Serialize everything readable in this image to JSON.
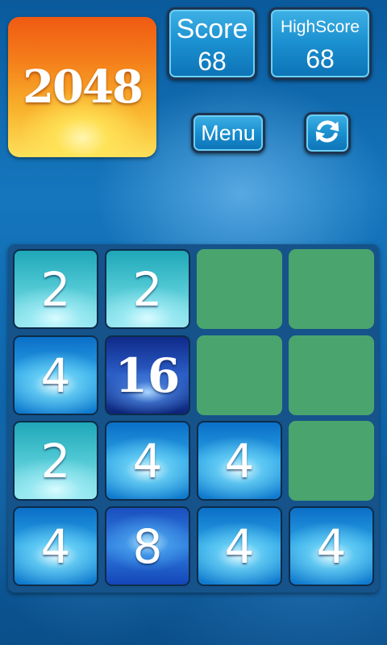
{
  "logo": {
    "text": "2048"
  },
  "score": {
    "label": "Score",
    "value": "68"
  },
  "high_score": {
    "label": "HighScore",
    "value": "68"
  },
  "menu_button": {
    "label": "Menu"
  },
  "restart_button": {
    "icon": "refresh-icon"
  },
  "board": {
    "rows": [
      [
        "2",
        "2",
        "",
        ""
      ],
      [
        "4",
        "16",
        "",
        ""
      ],
      [
        "2",
        "4",
        "4",
        ""
      ],
      [
        "4",
        "8",
        "4",
        "4"
      ]
    ]
  },
  "colors": {
    "empty_cell": "#4aa46e",
    "board_bg": "#15538a",
    "button_fill": "#1a8fcf",
    "logo_fill": "#f9b12b"
  }
}
